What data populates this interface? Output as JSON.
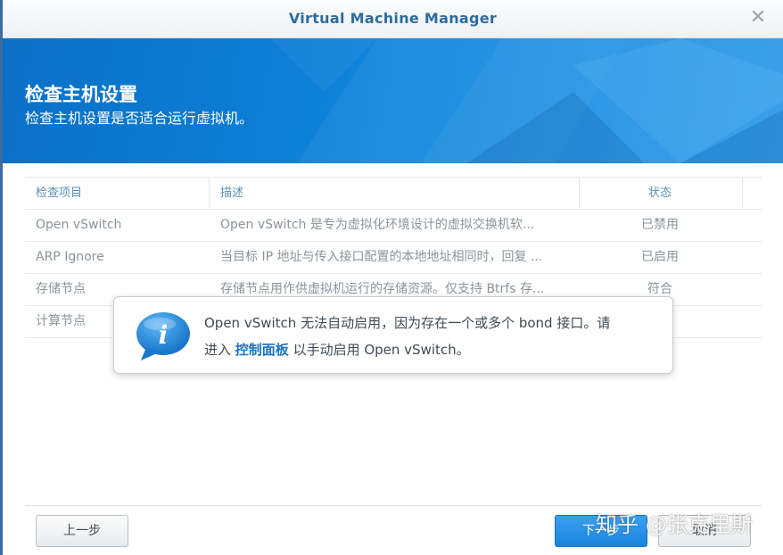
{
  "window": {
    "title": "Virtual Machine Manager"
  },
  "banner": {
    "title": "检查主机设置",
    "subtitle": "检查主机设置是否适合运行虚拟机。"
  },
  "table": {
    "headers": [
      "检查项目",
      "描述",
      "状态"
    ],
    "rows": [
      {
        "item": "Open vSwitch",
        "description": "Open vSwitch 是专为虚拟化环境设计的虚拟交换机软...",
        "status": "已禁用"
      },
      {
        "item": "ARP Ignore",
        "description": "当目标 IP 地址与传入接口配置的本地地址相同时，回复 ...",
        "status": "已启用"
      },
      {
        "item": "存储节点",
        "description": "存储节点用作供虚拟机运行的存储资源。仅支持 Btrfs 存...",
        "status": "符合"
      },
      {
        "item": "计算节点",
        "description": "",
        "status": ""
      }
    ]
  },
  "toast": {
    "line1": "Open vSwitch 无法自动启用，因为存在一个或多个 bond 接口。请",
    "line2_before": "进入 ",
    "link": "控制面板",
    "line2_after": " 以手动启用 Open vSwitch。",
    "icon": "info-icon"
  },
  "footer": {
    "prev_label": "上一步",
    "next_label": "下一步",
    "cancel_label": "取消"
  },
  "watermark": "知乎 @张克里斯",
  "colors": {
    "accent": "#1a84dc",
    "banner": "#0d80d8",
    "title": "#2d6c9f"
  }
}
